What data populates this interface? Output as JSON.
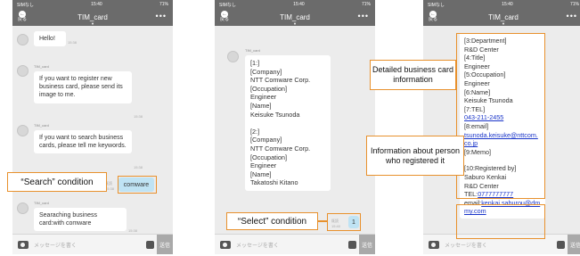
{
  "status": {
    "carrier": "SIMなし",
    "time": "15:40",
    "battery": "71%"
  },
  "nav": {
    "title": "TIM_card",
    "back_label": "戻る",
    "more": "•••"
  },
  "input": {
    "placeholder": "メッセージを書く",
    "send_label": "送信"
  },
  "screen1": {
    "sender": "TIM_card",
    "messages": [
      {
        "text": "Hello!",
        "time": "15:38"
      },
      {
        "text": "If you want to register new business card, please send its image to me.",
        "time": "15:38"
      },
      {
        "text": "If you want to search business cards, please tell me keywords.",
        "time": "15:38"
      },
      {
        "text": "Searaching business card:with comware",
        "time": "15:38"
      }
    ],
    "user_message": {
      "text": "comware",
      "read": "既読",
      "time": "15:38"
    }
  },
  "screen2": {
    "sender": "TIM_card",
    "result": "[1:]\n[Company]\nNTT Comware Corp.\n[Occupation]\nEngineer\n[Name]\nKeisuke Tsunoda\n\n[2:]\n[Company]\nNTT Comware Corp.\n[Occupation]\nEngineer\n[Name]\nTakatoshi Kitano",
    "user_message": {
      "text": "1",
      "read": "既読",
      "time": "15:40"
    }
  },
  "screen3": {
    "detail_lines": [
      "[3:Department]",
      "R&D Center",
      "[4:Title]",
      "Engineer",
      "[5:Occupation]",
      "Engineer",
      "[6:Name]",
      "Keisuke Tsunoda",
      "[7:TEL]"
    ],
    "tel": "043-211-2455",
    "email_label": "[8:email]",
    "email": "tsunoda.keisuke@nttcom.co.jp",
    "memo": "[9:Memo]",
    "registrant_lines": [
      "[10:Registered by]",
      "Saburo Kenkai",
      "R&D Center"
    ],
    "registrant_tel_label": "TEL:",
    "registrant_tel": "0777777777",
    "registrant_email_label": "email:",
    "registrant_email": "kenkai.saburou@dmmy.com"
  },
  "callouts": {
    "search": "“Search” condition",
    "select": "“Select” condition",
    "detail": "Detailed business card information",
    "registrant": "Information about person who registered it"
  },
  "colors": {
    "accent": "#e8912d",
    "header": "#6b6b6b",
    "user_bubble": "#bfe3f4",
    "link": "#1a35c9"
  }
}
